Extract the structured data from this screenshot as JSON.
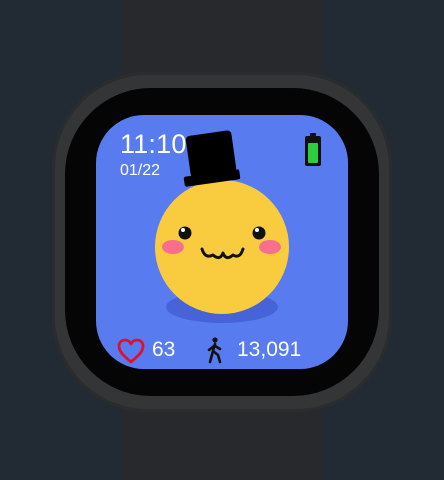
{
  "watchface": {
    "time": "11:10",
    "date": "01/22",
    "heart_rate": "63",
    "steps": "13,091",
    "battery_level": 1.0
  },
  "icons": {
    "heart": "heart-outline-icon",
    "steps": "walking-person-icon",
    "battery": "battery-icon",
    "character": "tophat-emoji-face"
  },
  "colors": {
    "background": "#222a33",
    "screen": "#587cf0",
    "battery_fill": "#2ecc40",
    "heart": "#e0102a",
    "face": "#f9cb3f",
    "cheek": "#f86f8d",
    "shadow": "#4664d8",
    "hat": "#000000",
    "text": "#ffffff"
  }
}
